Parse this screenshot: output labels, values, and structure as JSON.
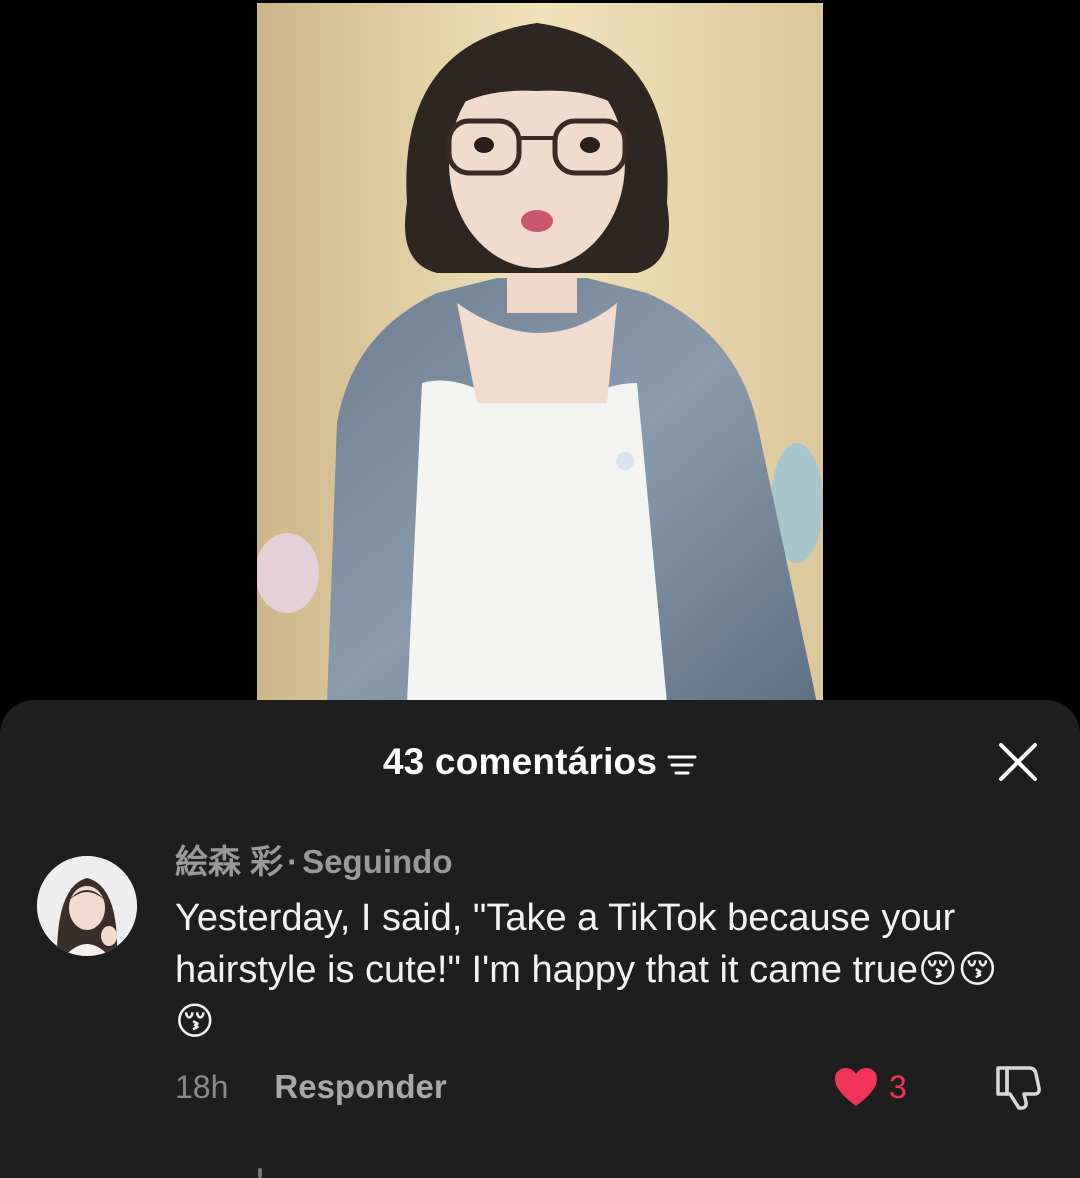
{
  "video": {
    "description_icon": "video-frame"
  },
  "comments_sheet": {
    "title": "43 comentários",
    "sort_icon": "sort-lines-icon",
    "close_icon": "close-icon"
  },
  "comment": {
    "author": "絵森 彩",
    "separator": "·",
    "relationship": "Seguindo",
    "text": "Yesterday, I said, \"Take a TikTok because your hairstyle is cute!\" I'm happy that it came true😚😚😚",
    "timestamp": "18h",
    "reply_label": "Responder",
    "like_count": "3",
    "like_icon": "heart-icon",
    "dislike_icon": "dislike-icon"
  },
  "colors": {
    "background": "#000000",
    "sheet": "#1e1e1e",
    "like": "#f0345a",
    "muted_text": "#9a9a9a"
  }
}
